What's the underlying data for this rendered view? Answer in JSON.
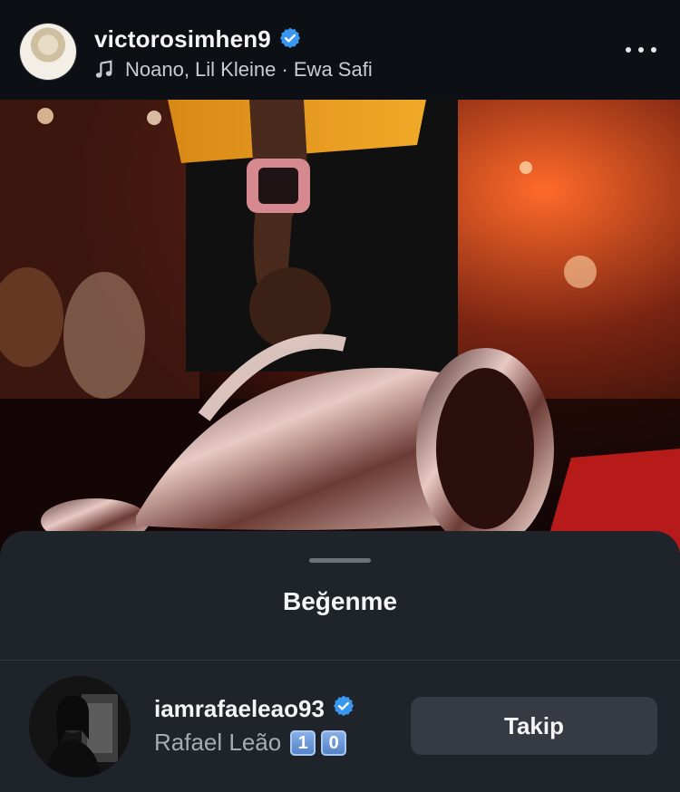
{
  "header": {
    "username": "victorosimhen9",
    "verified": true,
    "music": "Noano, Lil Kleine · Ewa Safi",
    "icons": {
      "verified": "verified-badge-icon",
      "music": "music-note-icon",
      "more": "more-options-icon"
    }
  },
  "post": {
    "image": "photo of player holding trophy in stadium with orange lights"
  },
  "sheet": {
    "title": "Beğenme",
    "row": {
      "username": "iamrafaeleao93",
      "verified": true,
      "display_name": "Rafael Leão",
      "emoji_digits": [
        "1",
        "0"
      ],
      "follow_label": "Takip"
    }
  },
  "colors": {
    "background": "#0c0f14",
    "sheet": "#1f232a",
    "button": "#363a43",
    "verified": "#3897f0",
    "secondary_text": "#a7abb2"
  }
}
